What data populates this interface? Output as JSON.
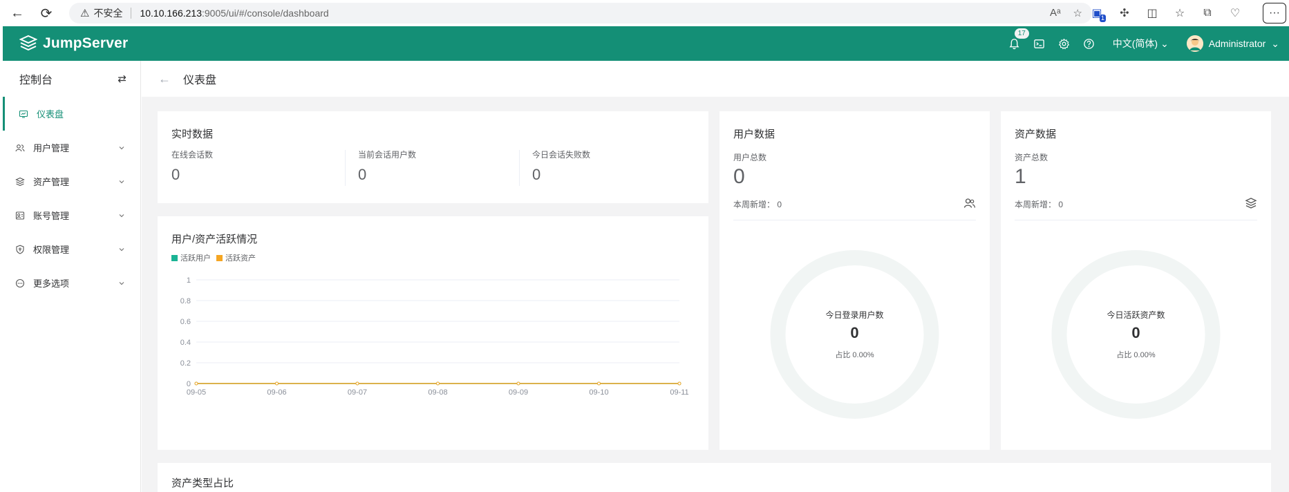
{
  "browser": {
    "insecure_label": "不安全",
    "url_host": "10.10.166.213",
    "url_path": ":9005/ui/#/console/dashboard",
    "ext_badge": "1"
  },
  "header": {
    "brand": "JumpServer",
    "notification_count": "17",
    "language": "中文(简体)",
    "user": "Administrator",
    "brand_color": "#148f76"
  },
  "sidebar": {
    "title": "控制台",
    "items": [
      {
        "label": "仪表盘",
        "icon": "dashboard-icon",
        "active": true
      },
      {
        "label": "用户管理",
        "icon": "users-icon"
      },
      {
        "label": "资产管理",
        "icon": "layers-icon"
      },
      {
        "label": "账号管理",
        "icon": "accounts-icon"
      },
      {
        "label": "权限管理",
        "icon": "shield-icon"
      },
      {
        "label": "更多选项",
        "icon": "more-icon"
      }
    ]
  },
  "page": {
    "title": "仪表盘"
  },
  "realtime": {
    "title": "实时数据",
    "metrics": [
      {
        "label": "在线会话数",
        "value": "0"
      },
      {
        "label": "当前会话用户数",
        "value": "0"
      },
      {
        "label": "今日会话失败数",
        "value": "0"
      }
    ]
  },
  "activity": {
    "title": "用户/资产活跃情况",
    "legend": [
      {
        "name": "活跃用户",
        "color": "#1ab394"
      },
      {
        "name": "活跃资产",
        "color": "#f5a623"
      }
    ]
  },
  "chart_data": {
    "type": "line",
    "title": "用户/资产活跃情况",
    "x": [
      "09-05",
      "09-06",
      "09-07",
      "09-08",
      "09-09",
      "09-10",
      "09-11"
    ],
    "series": [
      {
        "name": "活跃用户",
        "values": [
          0,
          0,
          0,
          0,
          0,
          0,
          0
        ],
        "color": "#1ab394"
      },
      {
        "name": "活跃资产",
        "values": [
          0,
          0,
          0,
          0,
          0,
          0,
          0
        ],
        "color": "#f5a623"
      }
    ],
    "ylim": [
      0,
      1
    ],
    "yticks": [
      "0",
      "0.2",
      "0.4",
      "0.6",
      "0.8",
      "1"
    ],
    "grid": true,
    "legend_position": "top-left"
  },
  "users": {
    "title": "用户数据",
    "total_label": "用户总数",
    "total_value": "0",
    "week_label": "本周新增：",
    "week_value": "0",
    "donut_title": "今日登录用户数",
    "donut_value": "0",
    "donut_ratio": "占比 0.00%"
  },
  "assets": {
    "title": "资产数据",
    "total_label": "资产总数",
    "total_value": "1",
    "week_label": "本周新增：",
    "week_value": "0",
    "donut_title": "今日活跃资产数",
    "donut_value": "0",
    "donut_ratio": "占比 0.00%"
  },
  "asset_types": {
    "title": "资产类型占比"
  }
}
